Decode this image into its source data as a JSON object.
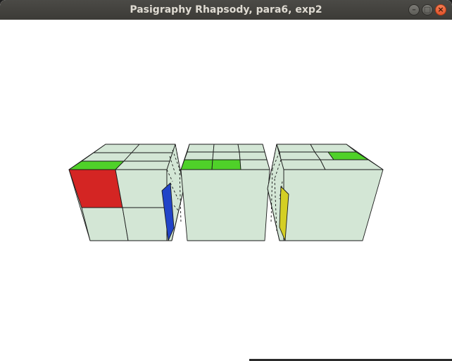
{
  "window": {
    "title": "Pasigraphy Rhapsody, para6, exp2",
    "controls": {
      "minimize_icon": "minimize-icon",
      "maximize_icon": "maximize-icon",
      "close_icon": "close-icon",
      "minimize_glyph": "–",
      "maximize_glyph": "□",
      "close_glyph": "×"
    }
  },
  "scene": {
    "background": "#ffffff",
    "face_color": "#d3e6d5",
    "edge_color": "#1a1a1a",
    "sticker_colors": {
      "green": "#4fd129",
      "red": "#d42523",
      "blue": "#2144c8",
      "yellow": "#d4cf24"
    },
    "cube_count": 3
  }
}
